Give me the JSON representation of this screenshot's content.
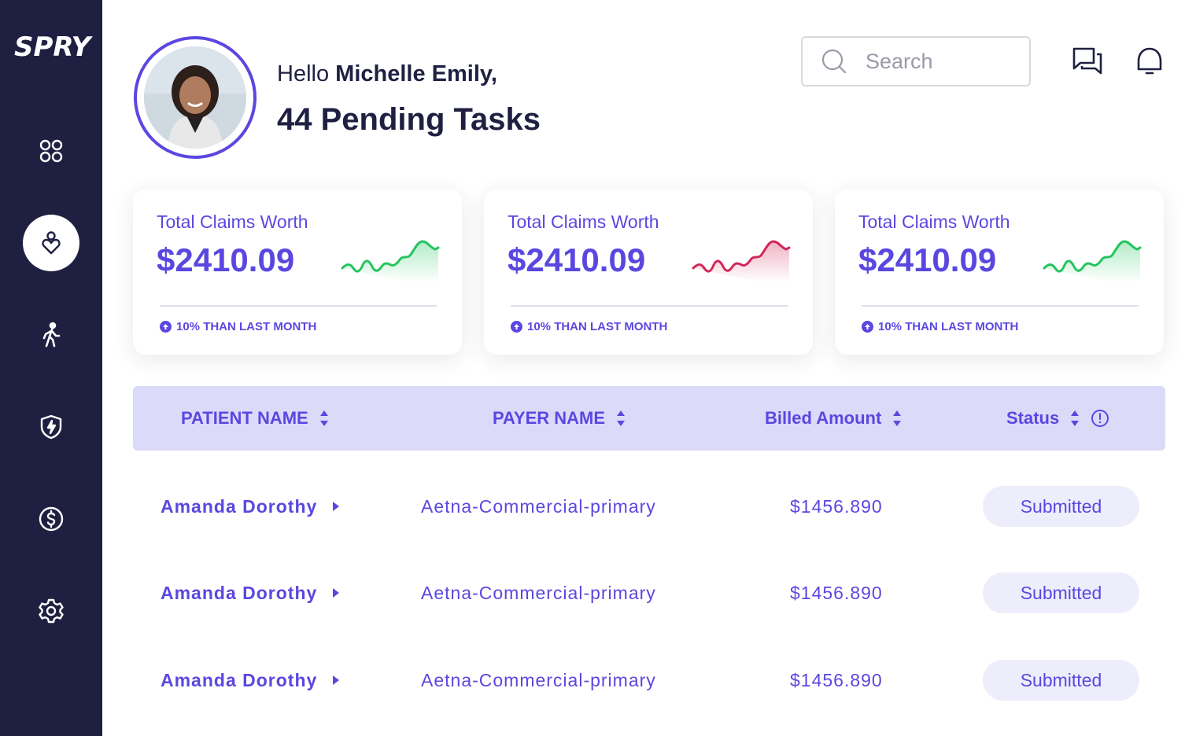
{
  "app": {
    "logo": "SPRY"
  },
  "sidebar": {
    "items": [
      {
        "icon": "grid-icon"
      },
      {
        "icon": "patient-heart-icon",
        "active": true
      },
      {
        "icon": "walking-person-icon"
      },
      {
        "icon": "shield-bolt-icon"
      },
      {
        "icon": "dollar-icon"
      },
      {
        "icon": "gear-icon"
      }
    ]
  },
  "header": {
    "greeting_prefix": "Hello ",
    "user_name": "Michelle Emily,",
    "pending": "44 Pending Tasks",
    "search_placeholder": "Search"
  },
  "cards": [
    {
      "title": "Total Claims Worth",
      "value": "$2410.09",
      "delta": "10% THAN LAST MONTH",
      "trend_color": "#22c55e"
    },
    {
      "title": "Total Claims Worth",
      "value": "$2410.09",
      "delta": "10% THAN LAST MONTH",
      "trend_color": "#d1275a"
    },
    {
      "title": "Total Claims Worth",
      "value": "$2410.09",
      "delta": "10% THAN LAST MONTH",
      "trend_color": "#22c55e"
    }
  ],
  "table": {
    "columns": [
      "PATIENT NAME",
      "PAYER NAME",
      "Billed Amount",
      "Status"
    ],
    "rows": [
      {
        "patient": "Amanda Dorothy",
        "payer": "Aetna-Commercial-primary",
        "amount": "$1456.890",
        "status": "Submitted"
      },
      {
        "patient": "Amanda Dorothy",
        "payer": "Aetna-Commercial-primary",
        "amount": "$1456.890",
        "status": "Submitted"
      },
      {
        "patient": "Amanda Dorothy",
        "payer": "Aetna-Commercial-primary",
        "amount": "$1456.890",
        "status": "Submitted"
      }
    ]
  },
  "colors": {
    "sidebar": "#1f2041",
    "accent": "#5b47e0",
    "header_bg": "#dcdaf9",
    "up": "#22c55e",
    "down": "#d1275a"
  }
}
